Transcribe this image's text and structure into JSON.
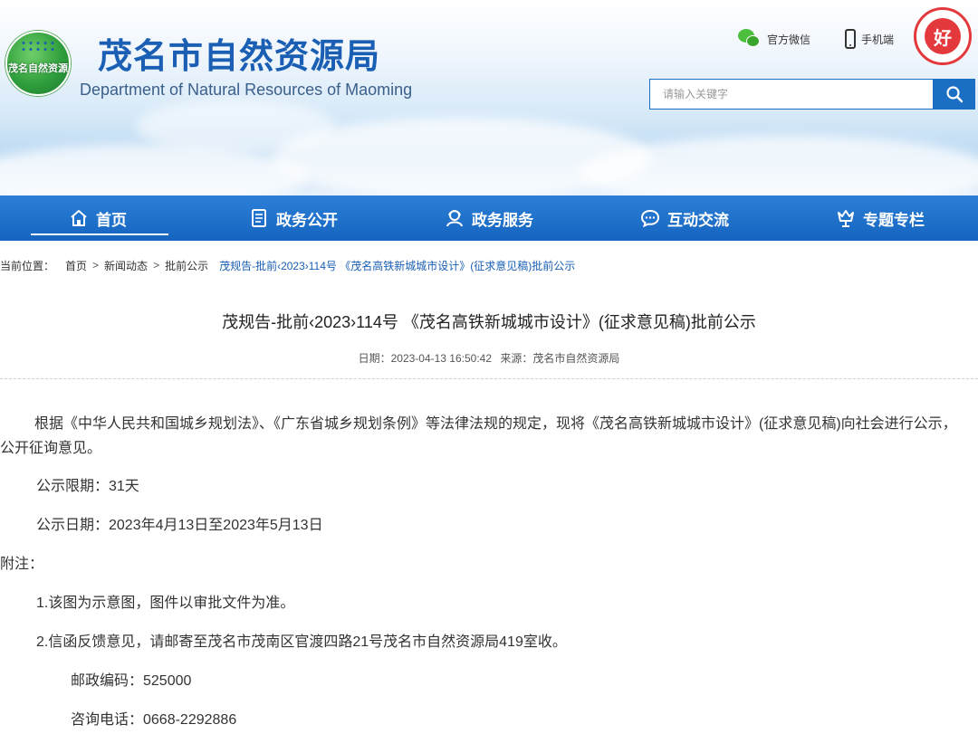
{
  "header": {
    "logo_text": "茂名自然资源",
    "title": "茂名市自然资源局",
    "subtitle": "Department of Natural Resources of Maoming",
    "wechat_label": "官方微信",
    "mobile_label": "手机端",
    "badge_text": "好",
    "search_placeholder": "请输入关键字"
  },
  "nav": {
    "items": [
      {
        "label": "首页",
        "icon": "home-icon",
        "active": true
      },
      {
        "label": "政务公开",
        "icon": "document-icon",
        "active": false
      },
      {
        "label": "政务服务",
        "icon": "service-icon",
        "active": false
      },
      {
        "label": "互动交流",
        "icon": "chat-icon",
        "active": false
      },
      {
        "label": "专题专栏",
        "icon": "special-icon",
        "active": false
      }
    ]
  },
  "breadcrumb": {
    "prefix": "当前位置：",
    "items": [
      "首页",
      "新闻动态",
      "批前公示"
    ],
    "current": "茂规告-批前‹2023›114号 《茂名高铁新城城市设计》(征求意见稿)批前公示"
  },
  "article": {
    "title": "茂规告-批前‹2023›114号 《茂名高铁新城城市设计》(征求意见稿)批前公示",
    "date": "日期：2023-04-13 16:50:42",
    "source": "来源：茂名市自然资源局",
    "paragraphs": [
      "根据《中华人民共和国城乡规划法》、《广东省城乡规划条例》等法律法规的规定，现将《茂名高铁新城城市设计》(征求意见稿)向社会进行公示，公开征询意见。",
      "公示限期：31天",
      "公示日期：2023年4月13日至2023年5月13日",
      "附注：",
      "1.该图为示意图，图件以审批文件为准。",
      "2.信函反馈意见，请邮寄至茂名市茂南区官渡四路21号茂名市自然资源局419室收。",
      "邮政编码：525000",
      "咨询电话：0668-2292886"
    ]
  },
  "colors": {
    "primary": "#1a6fc4",
    "nav_bg": "#1565c0",
    "title_blue": "#1a5fb4"
  }
}
